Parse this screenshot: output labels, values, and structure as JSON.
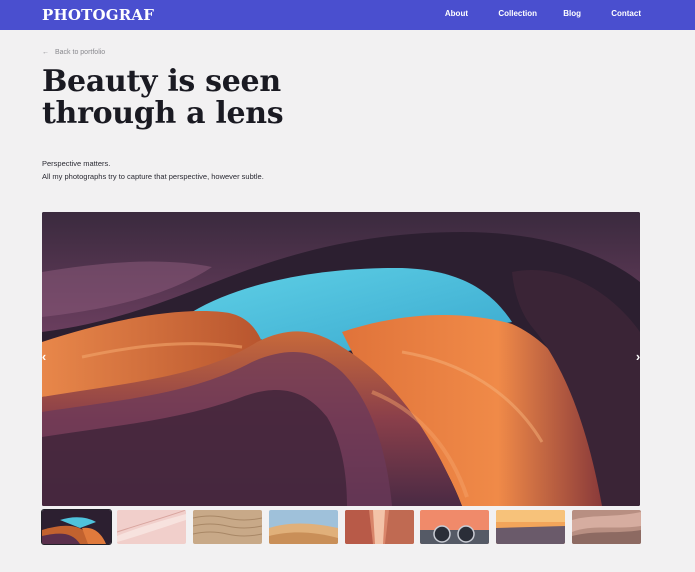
{
  "nav": {
    "brand": "PHOTOGRAF",
    "links": [
      "About",
      "Collection",
      "Blog",
      "Contact"
    ]
  },
  "back_link": {
    "arrow": "←",
    "label": "Back to portfolio"
  },
  "hero": {
    "title_lines": [
      "Beauty is seen",
      "through a lens"
    ],
    "description_lines": [
      "Perspective matters.",
      "All my photographs try to capture that perspective, however subtle."
    ]
  },
  "gallery": {
    "prev_label": "‹",
    "next_label": "›",
    "main_image": "sandstone-canyon-photo",
    "thumbnails": [
      "canyon-thumb",
      "pink-sand-thumb",
      "sand-ripples-thumb",
      "desert-dunes-thumb",
      "red-corridor-thumb",
      "camera-lens-thumb",
      "desert-sunset-thumb",
      "rock-formation-thumb"
    ],
    "active_index": 0
  },
  "colors": {
    "nav_bg": "#4a4fcf",
    "page_bg": "#f2f1f2",
    "title": "#1a1a22"
  }
}
